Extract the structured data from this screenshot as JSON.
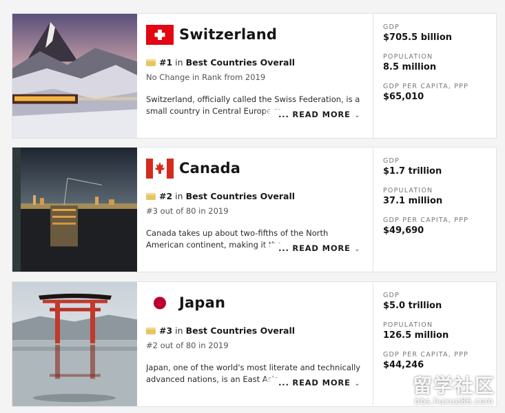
{
  "countries": [
    {
      "name": "Switzerland",
      "flag": "switzerland-flag",
      "rank": "#1",
      "rank_in": "in",
      "rank_list": "Best Countries Overall",
      "rank_change": "No Change in Rank from 2019",
      "description": "Switzerland, officially called the Swiss Federation, is a small country in Central Europe m",
      "read_more": "... READ MORE",
      "stats": [
        {
          "label": "GDP",
          "value": "$705.5 billion"
        },
        {
          "label": "POPULATION",
          "value": "8.5 million"
        },
        {
          "label": "GDP PER CAPITA, PPP",
          "value": "$65,010"
        }
      ]
    },
    {
      "name": "Canada",
      "flag": "canada-flag",
      "rank": "#2",
      "rank_in": "in",
      "rank_list": "Best Countries Overall",
      "rank_change": "#3 out of 80 in 2019",
      "description": "Canada takes up about two-fifths of the North American continent, making it the",
      "read_more": "... READ MORE",
      "stats": [
        {
          "label": "GDP",
          "value": "$1.7 trillion"
        },
        {
          "label": "POPULATION",
          "value": "37.1 million"
        },
        {
          "label": "GDP PER CAPITA, PPP",
          "value": "$49,690"
        }
      ]
    },
    {
      "name": "Japan",
      "flag": "japan-flag",
      "rank": "#3",
      "rank_in": "in",
      "rank_list": "Best Countries Overall",
      "rank_change": "#2 out of 80 in 2019",
      "description": "Japan, one of the world's most literate and technically advanced nations, is an East Asia",
      "read_more": "... READ MORE",
      "stats": [
        {
          "label": "GDP",
          "value": "$5.0 trillion"
        },
        {
          "label": "POPULATION",
          "value": "126.5 million"
        },
        {
          "label": "GDP PER CAPITA, PPP",
          "value": "$44,246"
        }
      ]
    }
  ],
  "watermark": {
    "title": "留学社区",
    "url": "bbs.liuxue86.com"
  },
  "colors": {
    "swiss_red": "#e30613",
    "canada_red": "#d52b1e",
    "japan_red": "#bc002d",
    "medal_gold": "#e6c567"
  }
}
